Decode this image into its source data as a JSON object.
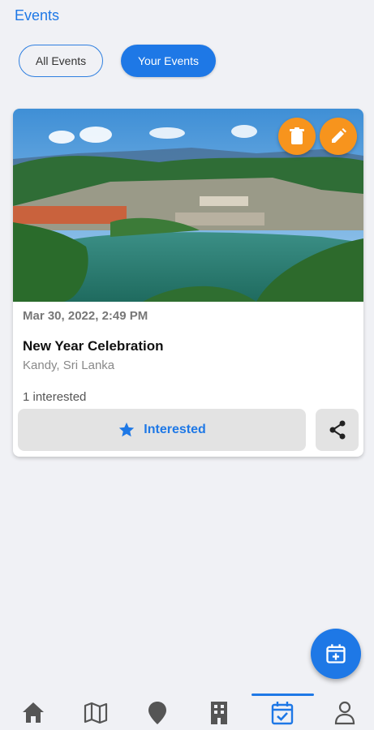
{
  "header": {
    "title": "Events"
  },
  "filters": {
    "all_label": "All Events",
    "yours_label": "Your Events",
    "active": "Your Events"
  },
  "event": {
    "date": "Mar 30, 2022, 2:49 PM",
    "title": "New Year Celebration",
    "location": "Kandy, Sri Lanka",
    "interested_count": "1 interested",
    "interested_label": "Interested",
    "delete_icon": "trash-icon",
    "edit_icon": "pencil-icon",
    "share_icon": "share-icon",
    "star_icon": "star-icon"
  },
  "fab": {
    "icon": "calendar-plus-icon"
  },
  "bottom_nav": {
    "items": [
      "home-icon",
      "map-icon",
      "location-pin-icon",
      "building-icon",
      "calendar-check-icon",
      "person-icon"
    ],
    "active": "calendar-check-icon"
  },
  "colors": {
    "accent": "#1e78e6",
    "action": "#f7941d",
    "background": "#f0f1f5"
  }
}
